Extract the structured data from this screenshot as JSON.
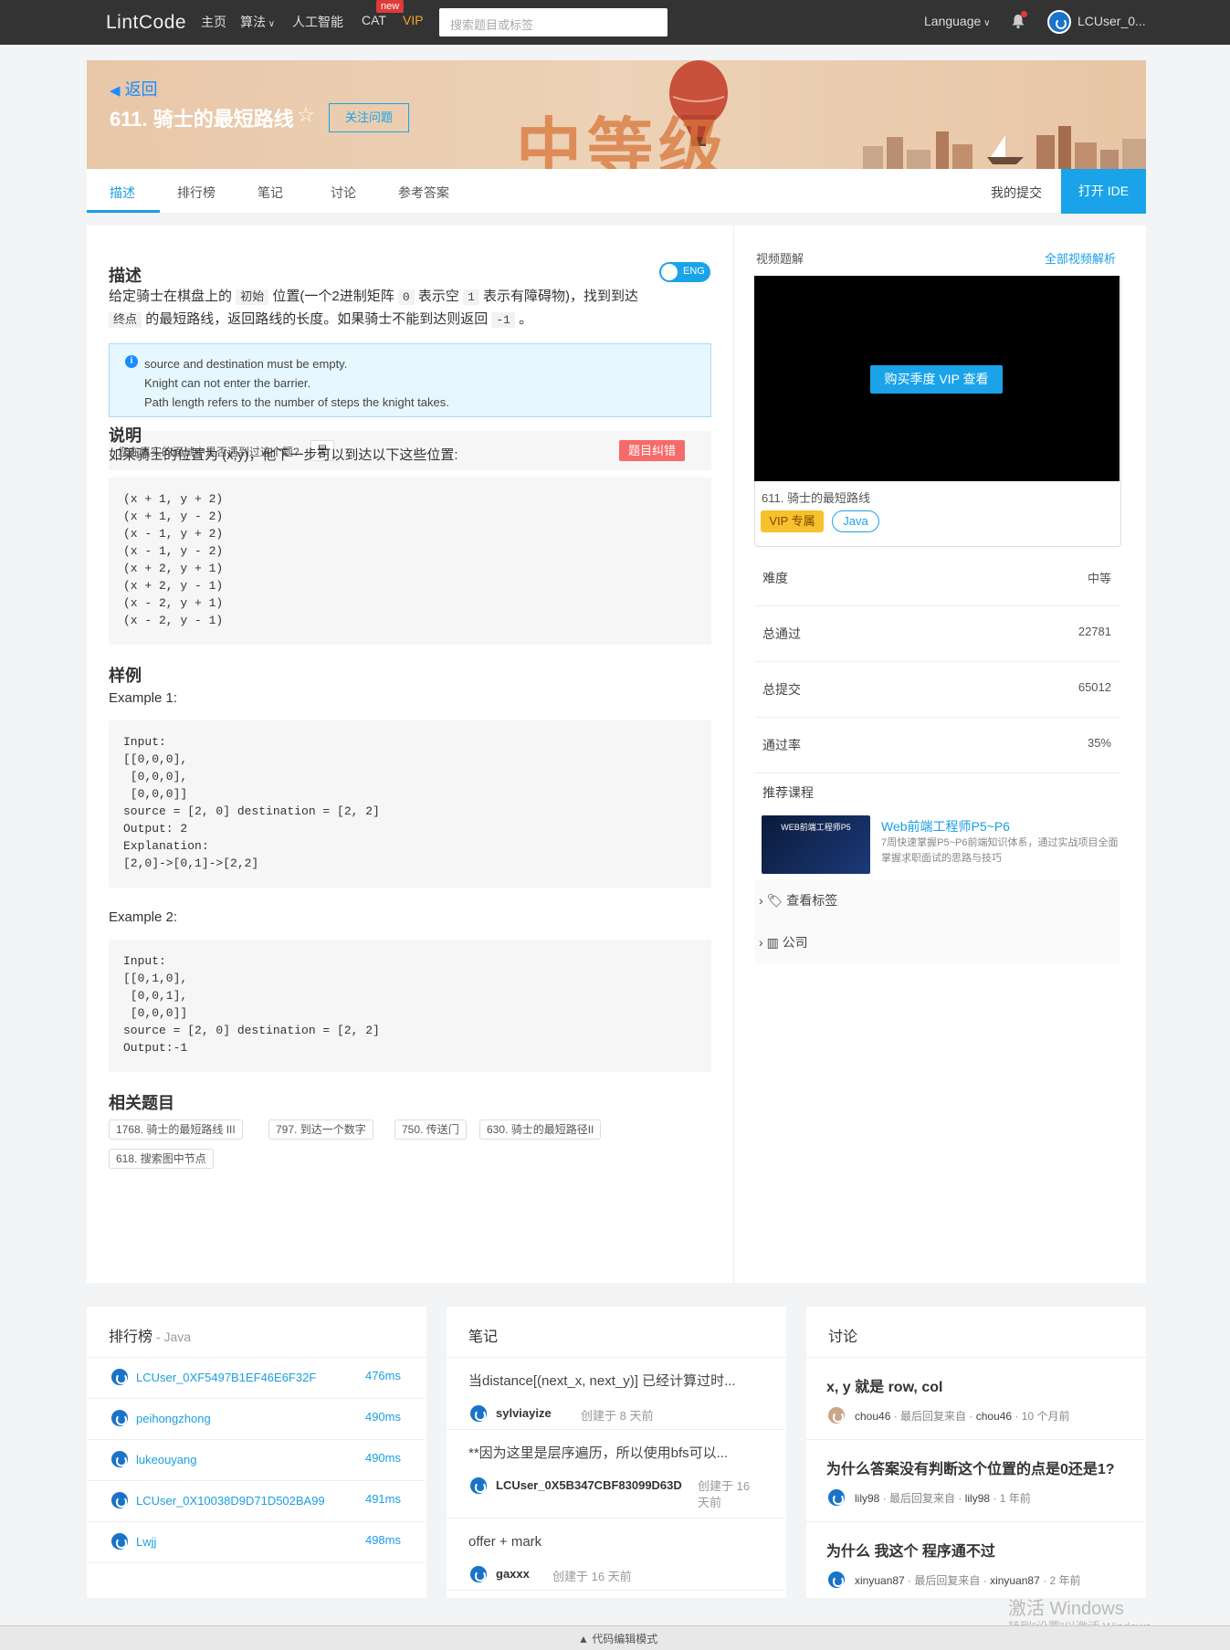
{
  "topbar": {
    "logo": "LintCode",
    "nav": [
      "主页",
      "算法",
      "人工智能",
      "CAT",
      "VIP"
    ],
    "new_badge": "new",
    "search_placeholder": "搜索题目或标签",
    "language": "Language",
    "username": "LCUser_0..."
  },
  "banner": {
    "back": "返回",
    "title": "611. 骑士的最短路线",
    "follow": "关注问题",
    "level": "中等级"
  },
  "tabs": {
    "items": [
      "描述",
      "排行榜",
      "笔记",
      "讨论",
      "参考答案"
    ],
    "my_submissions": "我的提交",
    "open_ide": "打开 IDE"
  },
  "desc": {
    "heading": "描述",
    "toggle": "ENG",
    "p1a": "给定骑士在棋盘上的",
    "c1": "初始",
    "p1b": "位置(一个2进制矩阵",
    "c2": "0",
    "p1c": "表示空",
    "c3": "1",
    "p1d": "表示有障碍物)，找到到达",
    "c4": "终点",
    "p2a": "的最短路线，返回路线的长度。如果骑士不能到达则返回",
    "c5": "-1",
    "p2b": "。",
    "note_lines": [
      "source and destination must be empty.",
      "Knight can not enter the barrier.",
      "Path length refers to the number of steps the knight takes."
    ],
    "survey_q": "您在真实的面试中是否遇到过这个题?",
    "survey_yes": "是",
    "correction": "题目纠错",
    "explain_heading": "说明",
    "explain_text": "如果骑士的位置为 (x,y)，他下一步可以到达以下这些位置:",
    "moves": "(x + 1, y + 2)\n(x + 1, y - 2)\n(x - 1, y + 2)\n(x - 1, y - 2)\n(x + 2, y + 1)\n(x + 2, y - 1)\n(x - 2, y + 1)\n(x - 2, y - 1)",
    "examples_heading": "样例",
    "ex1_title": "Example 1:",
    "ex1_code": "Input:\n[[0,0,0],\n [0,0,0],\n [0,0,0]]\nsource = [2, 0] destination = [2, 2]\nOutput: 2\nExplanation:\n[2,0]->[0,1]->[2,2]",
    "ex2_title": "Example 2:",
    "ex2_code": "Input:\n[[0,1,0],\n [0,0,1],\n [0,0,0]]\nsource = [2, 0] destination = [2, 2]\nOutput:-1",
    "related_heading": "相关题目",
    "related": [
      "1768. 骑士的最短路线 III",
      "797. 到达一个数字",
      "750. 传送门",
      "630. 骑士的最短路径II",
      "618. 搜索图中节点"
    ]
  },
  "side": {
    "video_label": "视频题解",
    "all_videos": "全部视频解析",
    "buy_vip": "购买季度 VIP 查看",
    "video_title": "611. 骑士的最短路线",
    "vip_tag": "VIP 专属",
    "java_tag": "Java",
    "stats": [
      {
        "k": "难度",
        "v": "中等"
      },
      {
        "k": "总通过",
        "v": "22781"
      },
      {
        "k": "总提交",
        "v": "65012"
      },
      {
        "k": "通过率",
        "v": "35%"
      }
    ],
    "recommend": "推荐课程",
    "course_img_text": "WEB前端工程师P5",
    "course_title": "Web前端工程师P5~P6",
    "course_desc": "7周快速掌握P5~P6前端知识体系，通过实战项目全面掌握求职面试的思路与技巧",
    "tags": "查看标签",
    "company": "公司"
  },
  "ranking": {
    "title": "排行榜",
    "lang": " - Java",
    "rows": [
      {
        "name": "LCUser_0XF5497B1EF46E6F32F",
        "time": "476ms"
      },
      {
        "name": "peihongzhong",
        "time": "490ms"
      },
      {
        "name": "lukeouyang",
        "time": "490ms"
      },
      {
        "name": "LCUser_0X10038D9D71D502BA99",
        "time": "491ms"
      },
      {
        "name": "Lwjj",
        "time": "498ms"
      }
    ]
  },
  "notes": {
    "title": "笔记",
    "rows": [
      {
        "text": "当distance[(next_x, next_y)] 已经计算过时...",
        "user": "sylviayize",
        "date": "创建于 8 天前"
      },
      {
        "text": "**因为这里是层序遍历，所以使用bfs可以...",
        "user": "LCUser_0X5B347CBF83099D63D",
        "date": "创建于 16 天前"
      },
      {
        "text": "offer + mark",
        "user": "gaxxx",
        "date": "创建于 16 天前"
      }
    ]
  },
  "discuss": {
    "title": "讨论",
    "rows": [
      {
        "text": "x, y 就是 row, col",
        "user": "chou46",
        "mid": " · 最后回复来自 · ",
        "user2": "chou46",
        "time": " · 10 个月前"
      },
      {
        "text": "为什么答案没有判断这个位置的点是0还是1?",
        "user": "lily98",
        "mid": " · 最后回复来自 · ",
        "user2": "lily98",
        "time": " · 1 年前"
      },
      {
        "text": "为什么 我这个 程序通不过",
        "user": "xinyuan87",
        "mid": " · 最后回复来自 · ",
        "user2": "xinyuan87",
        "time": " · 2 年前"
      }
    ]
  },
  "footer": {
    "editor_mode": "代码编辑模式",
    "watermark1": "激活 Windows",
    "watermark2": "转到\"设置\"以激活 Windows。"
  }
}
